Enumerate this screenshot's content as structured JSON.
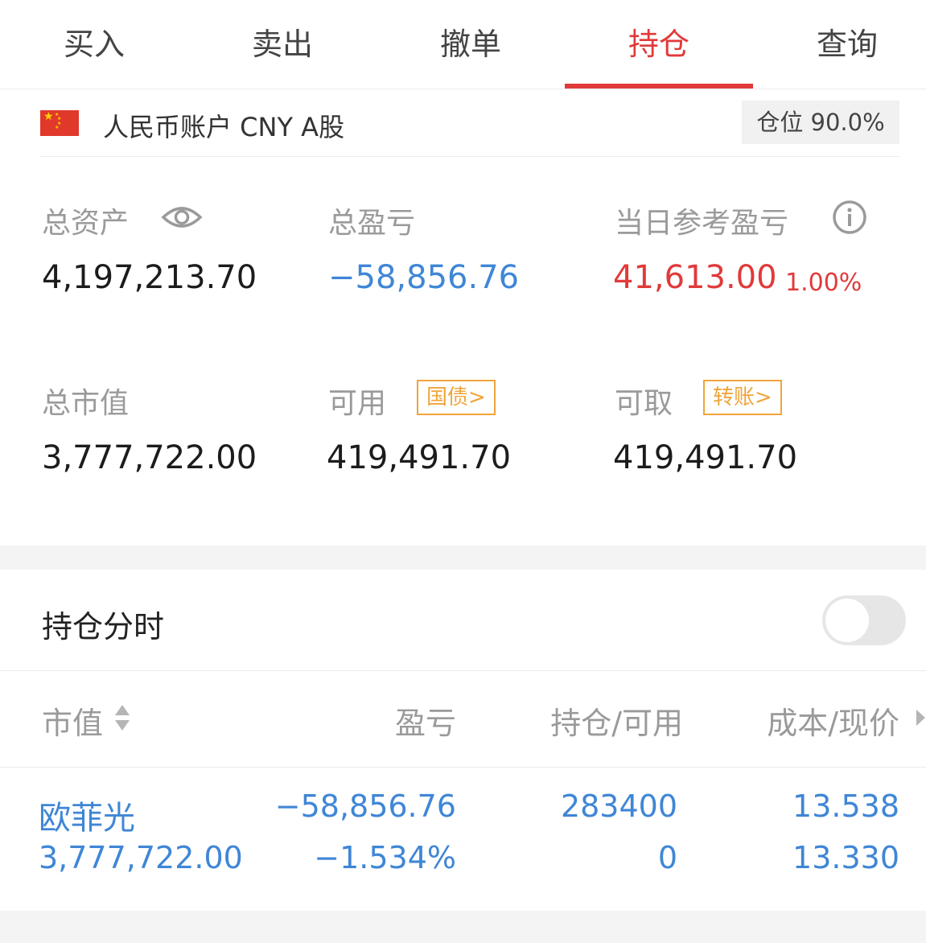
{
  "tabs": [
    {
      "label": "买入"
    },
    {
      "label": "卖出"
    },
    {
      "label": "撤单"
    },
    {
      "label": "持仓"
    },
    {
      "label": "查询"
    }
  ],
  "active_tab": "持仓",
  "colors": {
    "accent": "#e03a3a",
    "loss_blue": "#3f86d6",
    "tag_orange": "#f0a43a"
  },
  "account": {
    "label": "人民币账户 CNY A股",
    "position_badge": "仓位 90.0%"
  },
  "summary": {
    "total_assets_label": "总资产",
    "total_assets": "4,197,213.70",
    "total_pl_label": "总盈亏",
    "total_pl": "−58,856.76",
    "daily_pl_label": "当日参考盈亏",
    "daily_pl": "41,613.00",
    "daily_pl_pct": "1.00%",
    "market_value_label": "总市值",
    "market_value": "3,777,722.00",
    "available_label": "可用",
    "available_tag": "国债>",
    "available": "419,491.70",
    "withdrawable_label": "可取",
    "withdrawable_tag": "转账>",
    "withdrawable": "419,491.70"
  },
  "holdings_timeline": {
    "label": "持仓分时",
    "toggle_on": false
  },
  "table": {
    "headers": [
      "市值",
      "盈亏",
      "持仓/可用",
      "成本/现价"
    ],
    "rows": [
      {
        "name": "欧菲光",
        "market_value": "3,777,722.00",
        "pl": "−58,856.76",
        "pl_pct": "−1.534%",
        "holding": "283400",
        "available": "0",
        "cost": "13.538",
        "price": "13.330"
      }
    ]
  },
  "icons": [
    "eye-icon",
    "info-icon",
    "sort-icon",
    "chevron-right-icon",
    "china-flag-icon"
  ]
}
